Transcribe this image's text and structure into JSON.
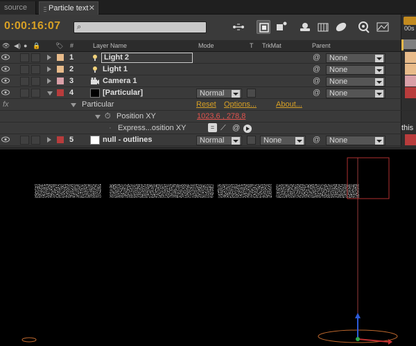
{
  "tabs": {
    "source": "source",
    "active": "Particle text"
  },
  "toolbar": {
    "timecode": "0:00:16:07",
    "search_placeholder": ""
  },
  "ruler": {
    "tick": "00s"
  },
  "columns": {
    "hash": "#",
    "layer_name": "Layer Name",
    "mode": "Mode",
    "t": "T",
    "trkmat": "TrkMat",
    "parent": "Parent"
  },
  "layers": [
    {
      "num": "1",
      "name": "Light 2",
      "label_color": "#e8bb8a",
      "parent": "None"
    },
    {
      "num": "2",
      "name": "Light 1",
      "label_color": "#e8bb8a",
      "parent": "None"
    },
    {
      "num": "3",
      "name": "Camera 1",
      "label_color": "#d9a0a8",
      "parent": "None"
    },
    {
      "num": "4",
      "name": "[Particular]",
      "label_color": "#b83c3c",
      "mode": "Normal",
      "parent": "None"
    },
    {
      "num": "5",
      "name": "null - outlines",
      "label_color": "#b83c3c",
      "mode": "Normal",
      "trkmat": "None",
      "parent": "None"
    }
  ],
  "effect": {
    "fx": "fx",
    "name": "Particular",
    "reset": "Reset",
    "options": "Options...",
    "about": "About...",
    "property": "Position XY",
    "value": "1023,6 , 278,8",
    "expression": "Express...osition XY",
    "right_text": "this"
  },
  "colors": {
    "timecode": "#d7a025",
    "link": "#d7a025",
    "value": "#e0534e"
  }
}
